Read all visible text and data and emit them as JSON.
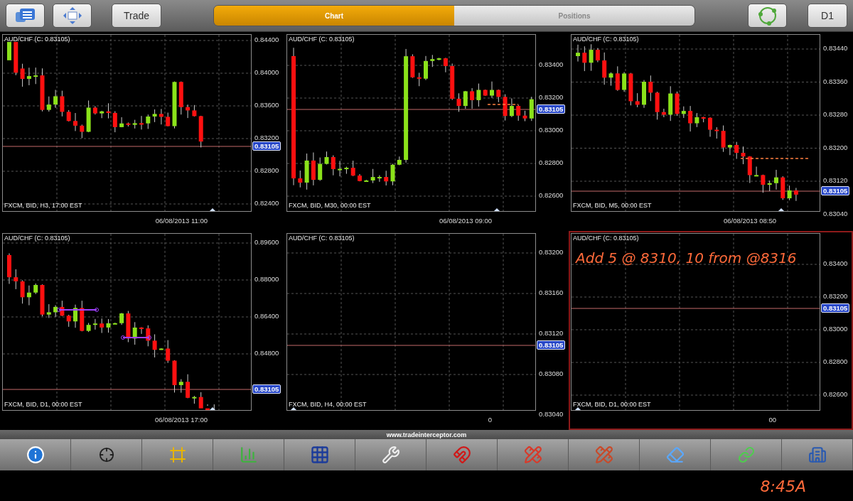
{
  "top_bar": {
    "trade_button": "Trade",
    "tabs": [
      {
        "label": "Chart",
        "selected": true
      },
      {
        "label": "Positions",
        "selected": false
      }
    ],
    "timeframe_button": "D1"
  },
  "charts": [
    {
      "title": "AUD/CHF (C: 0.83105)",
      "info": "FXCM, BID, H3, 17:00 EST",
      "date": "06/08/2013 11:00",
      "yticks": [
        "0.84400",
        "0.84000",
        "0.83600",
        "0.83200",
        "0.82800",
        "0.82400"
      ],
      "price_tag": "0.83105",
      "selected": false
    },
    {
      "title": "AUD/CHF (C: 0.83105)",
      "info": "FXCM, BID, M30, 00:00 EST",
      "date": "06/08/2013 09:00",
      "yticks": [
        "0.83400",
        "0.83200",
        "0.83000",
        "0.82800",
        "0.82600"
      ],
      "price_tag": "0.83105",
      "selected": false
    },
    {
      "title": "AUD/CHF (C: 0.83105)",
      "info": "FXCM, BID, M5, 00:00 EST",
      "date": "06/08/2013 08:50",
      "yticks": [
        "0.83440",
        "0.83360",
        "0.83280",
        "0.83200",
        "0.83120",
        "0.83040"
      ],
      "price_tag": "0.83105",
      "selected": false
    },
    {
      "title": "AUD/CHF (C: 0.83105)",
      "info": "FXCM, BID, D1, 00:00 EST",
      "date": "06/08/2013 17:00",
      "yticks": [
        "0.89600",
        "0.88000",
        "0.86400",
        "0.84800"
      ],
      "price_tag": "0.83105",
      "selected": false
    },
    {
      "title": "AUD/CHF (C: 0.83105)",
      "info": "FXCM, BID, H4, 00:00 EST",
      "date": "0",
      "yticks": [
        "0.83200",
        "0.83160",
        "0.83120",
        "0.83080",
        "0.83040"
      ],
      "price_tag": "0.83105",
      "selected": false
    },
    {
      "title": "AUD/CHF (C: 0.83105)",
      "info": "FXCM, BID, D1, 00:00 EST",
      "date": "00",
      "yticks": [
        "0.83400",
        "0.83200",
        "0.83000",
        "0.82800",
        "0.82600"
      ],
      "price_tag": "0.83105",
      "selected": true,
      "note": "Add 5 @ 8310, 10 from @8316"
    }
  ],
  "website": "www.tradeinterceptor.com",
  "handwritten_time": "8:45A"
}
